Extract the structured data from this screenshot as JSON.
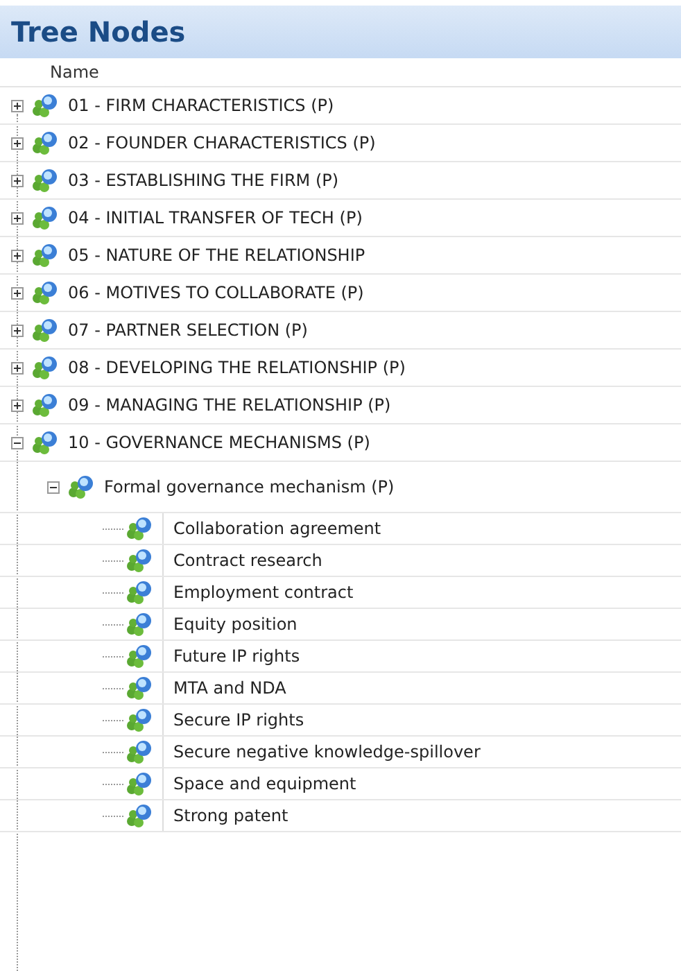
{
  "panel": {
    "title": "Tree Nodes"
  },
  "columns": [
    "Name"
  ],
  "nodes": [
    {
      "label": "01 - FIRM CHARACTERISTICS (P)",
      "expanded": false
    },
    {
      "label": "02 - FOUNDER CHARACTERISTICS (P)",
      "expanded": false
    },
    {
      "label": "03 - ESTABLISHING THE FIRM (P)",
      "expanded": false
    },
    {
      "label": "04 - INITIAL TRANSFER OF TECH (P)",
      "expanded": false
    },
    {
      "label": "05 - NATURE OF THE RELATIONSHIP",
      "expanded": false
    },
    {
      "label": "06 - MOTIVES TO COLLABORATE (P)",
      "expanded": false
    },
    {
      "label": "07 - PARTNER SELECTION (P)",
      "expanded": false
    },
    {
      "label": "08 - DEVELOPING THE RELATIONSHIP (P)",
      "expanded": false
    },
    {
      "label": "09 - MANAGING THE RELATIONSHIP (P)",
      "expanded": false
    },
    {
      "label": "10 - GOVERNANCE MECHANISMS (P)",
      "expanded": true,
      "children": [
        {
          "label": "Formal governance mechanism (P)",
          "expanded": true,
          "children": [
            {
              "label": "Collaboration agreement"
            },
            {
              "label": "Contract research"
            },
            {
              "label": "Employment contract"
            },
            {
              "label": "Equity position"
            },
            {
              "label": "Future IP rights"
            },
            {
              "label": "MTA and NDA"
            },
            {
              "label": "Secure IP rights"
            },
            {
              "label": "Secure negative knowledge-spillover"
            },
            {
              "label": "Space and equipment"
            },
            {
              "label": "Strong patent"
            }
          ]
        }
      ]
    }
  ]
}
